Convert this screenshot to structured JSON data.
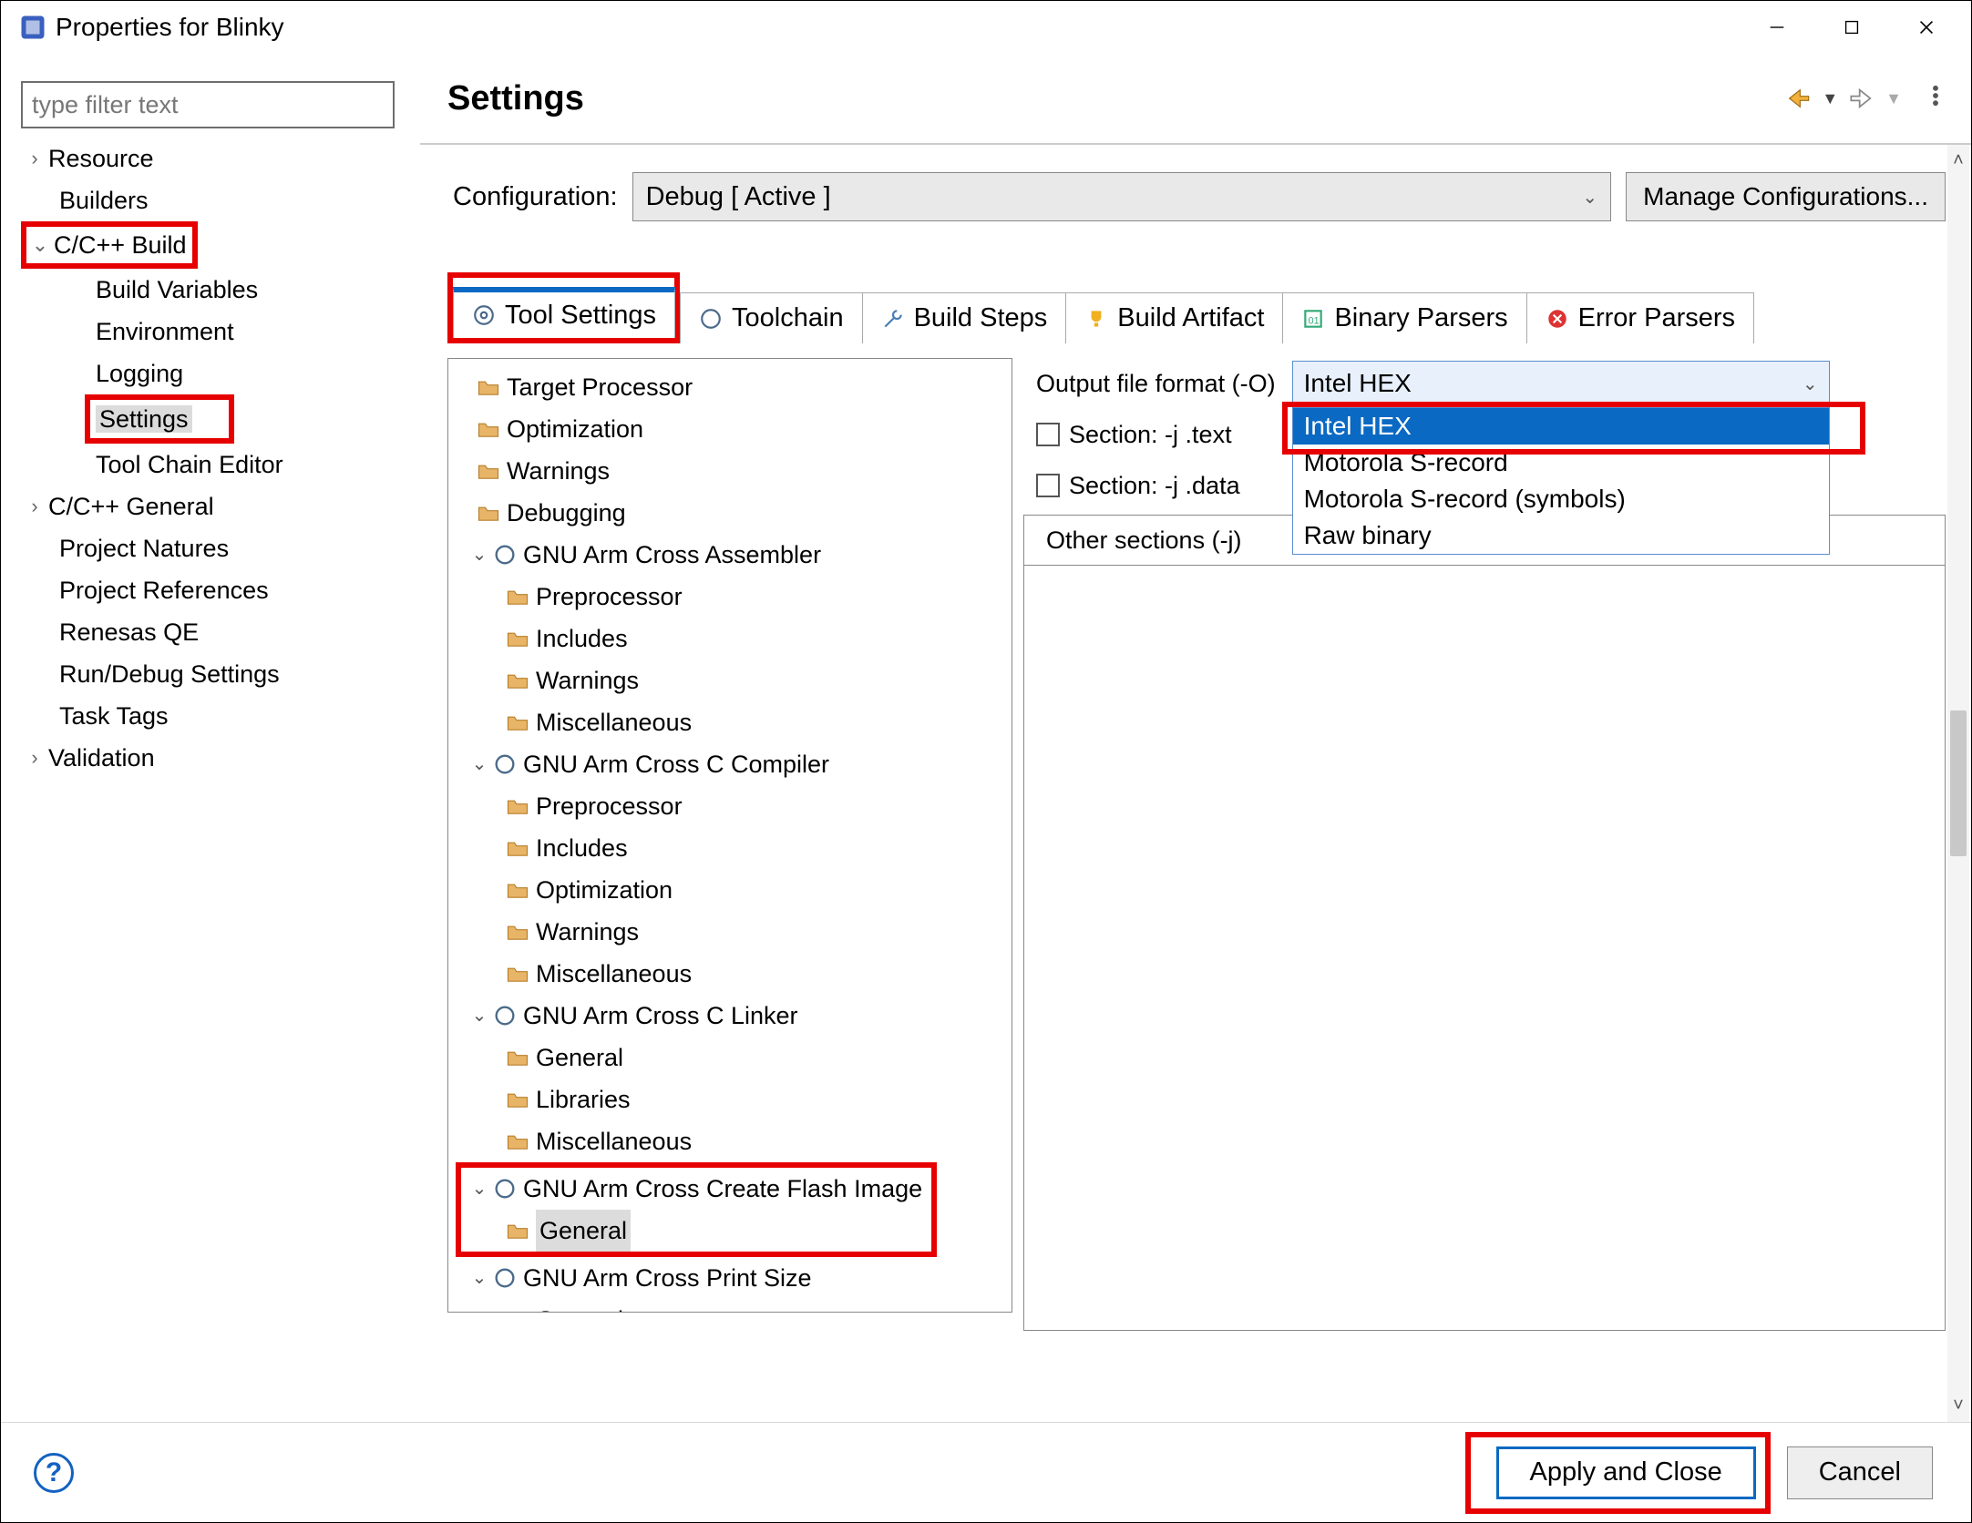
{
  "window": {
    "title": "Properties for Blinky"
  },
  "left": {
    "filter_placeholder": "type filter text",
    "items": {
      "resource": "Resource",
      "builders": "Builders",
      "cpp_build": "C/C++ Build",
      "build_vars": "Build Variables",
      "environment": "Environment",
      "logging": "Logging",
      "settings": "Settings",
      "tool_chain_editor": "Tool Chain Editor",
      "cpp_general": "C/C++ General",
      "project_natures": "Project Natures",
      "project_refs": "Project References",
      "renesas_qe": "Renesas QE",
      "run_debug": "Run/Debug Settings",
      "task_tags": "Task Tags",
      "validation": "Validation"
    }
  },
  "right": {
    "header_title": "Settings",
    "config_label": "Configuration:",
    "config_value": "Debug  [ Active ]",
    "manage_label": "Manage Configurations...",
    "tabs": {
      "tool_settings": "Tool Settings",
      "toolchain": "Toolchain",
      "build_steps": "Build Steps",
      "build_artifact": "Build Artifact",
      "binary_parsers": "Binary Parsers",
      "error_parsers": "Error Parsers"
    },
    "tool_tree": {
      "target_processor": "Target Processor",
      "optimization": "Optimization",
      "warnings": "Warnings",
      "debugging": "Debugging",
      "asm": "GNU Arm Cross Assembler",
      "asm_preprocessor": "Preprocessor",
      "asm_includes": "Includes",
      "asm_warnings": "Warnings",
      "asm_misc": "Miscellaneous",
      "cc": "GNU Arm Cross C Compiler",
      "cc_preprocessor": "Preprocessor",
      "cc_includes": "Includes",
      "cc_optimization": "Optimization",
      "cc_warnings": "Warnings",
      "cc_misc": "Miscellaneous",
      "ld": "GNU Arm Cross C Linker",
      "ld_general": "General",
      "ld_libraries": "Libraries",
      "ld_misc": "Miscellaneous",
      "flash": "GNU Arm Cross Create Flash Image",
      "flash_general": "General",
      "size": "GNU Arm Cross Print Size",
      "size_general": "General"
    },
    "form": {
      "output_format_label": "Output file format (-O)",
      "output_format_value": "Intel HEX",
      "section_text": "Section: -j .text",
      "section_data": "Section: -j .data",
      "other_sections": "Other sections (-j)",
      "options": {
        "ihex": "Intel HEX",
        "srec": "Motorola S-record",
        "srec_sym": "Motorola S-record (symbols)",
        "raw": "Raw binary"
      }
    }
  },
  "footer": {
    "apply_close": "Apply and Close",
    "cancel": "Cancel"
  }
}
